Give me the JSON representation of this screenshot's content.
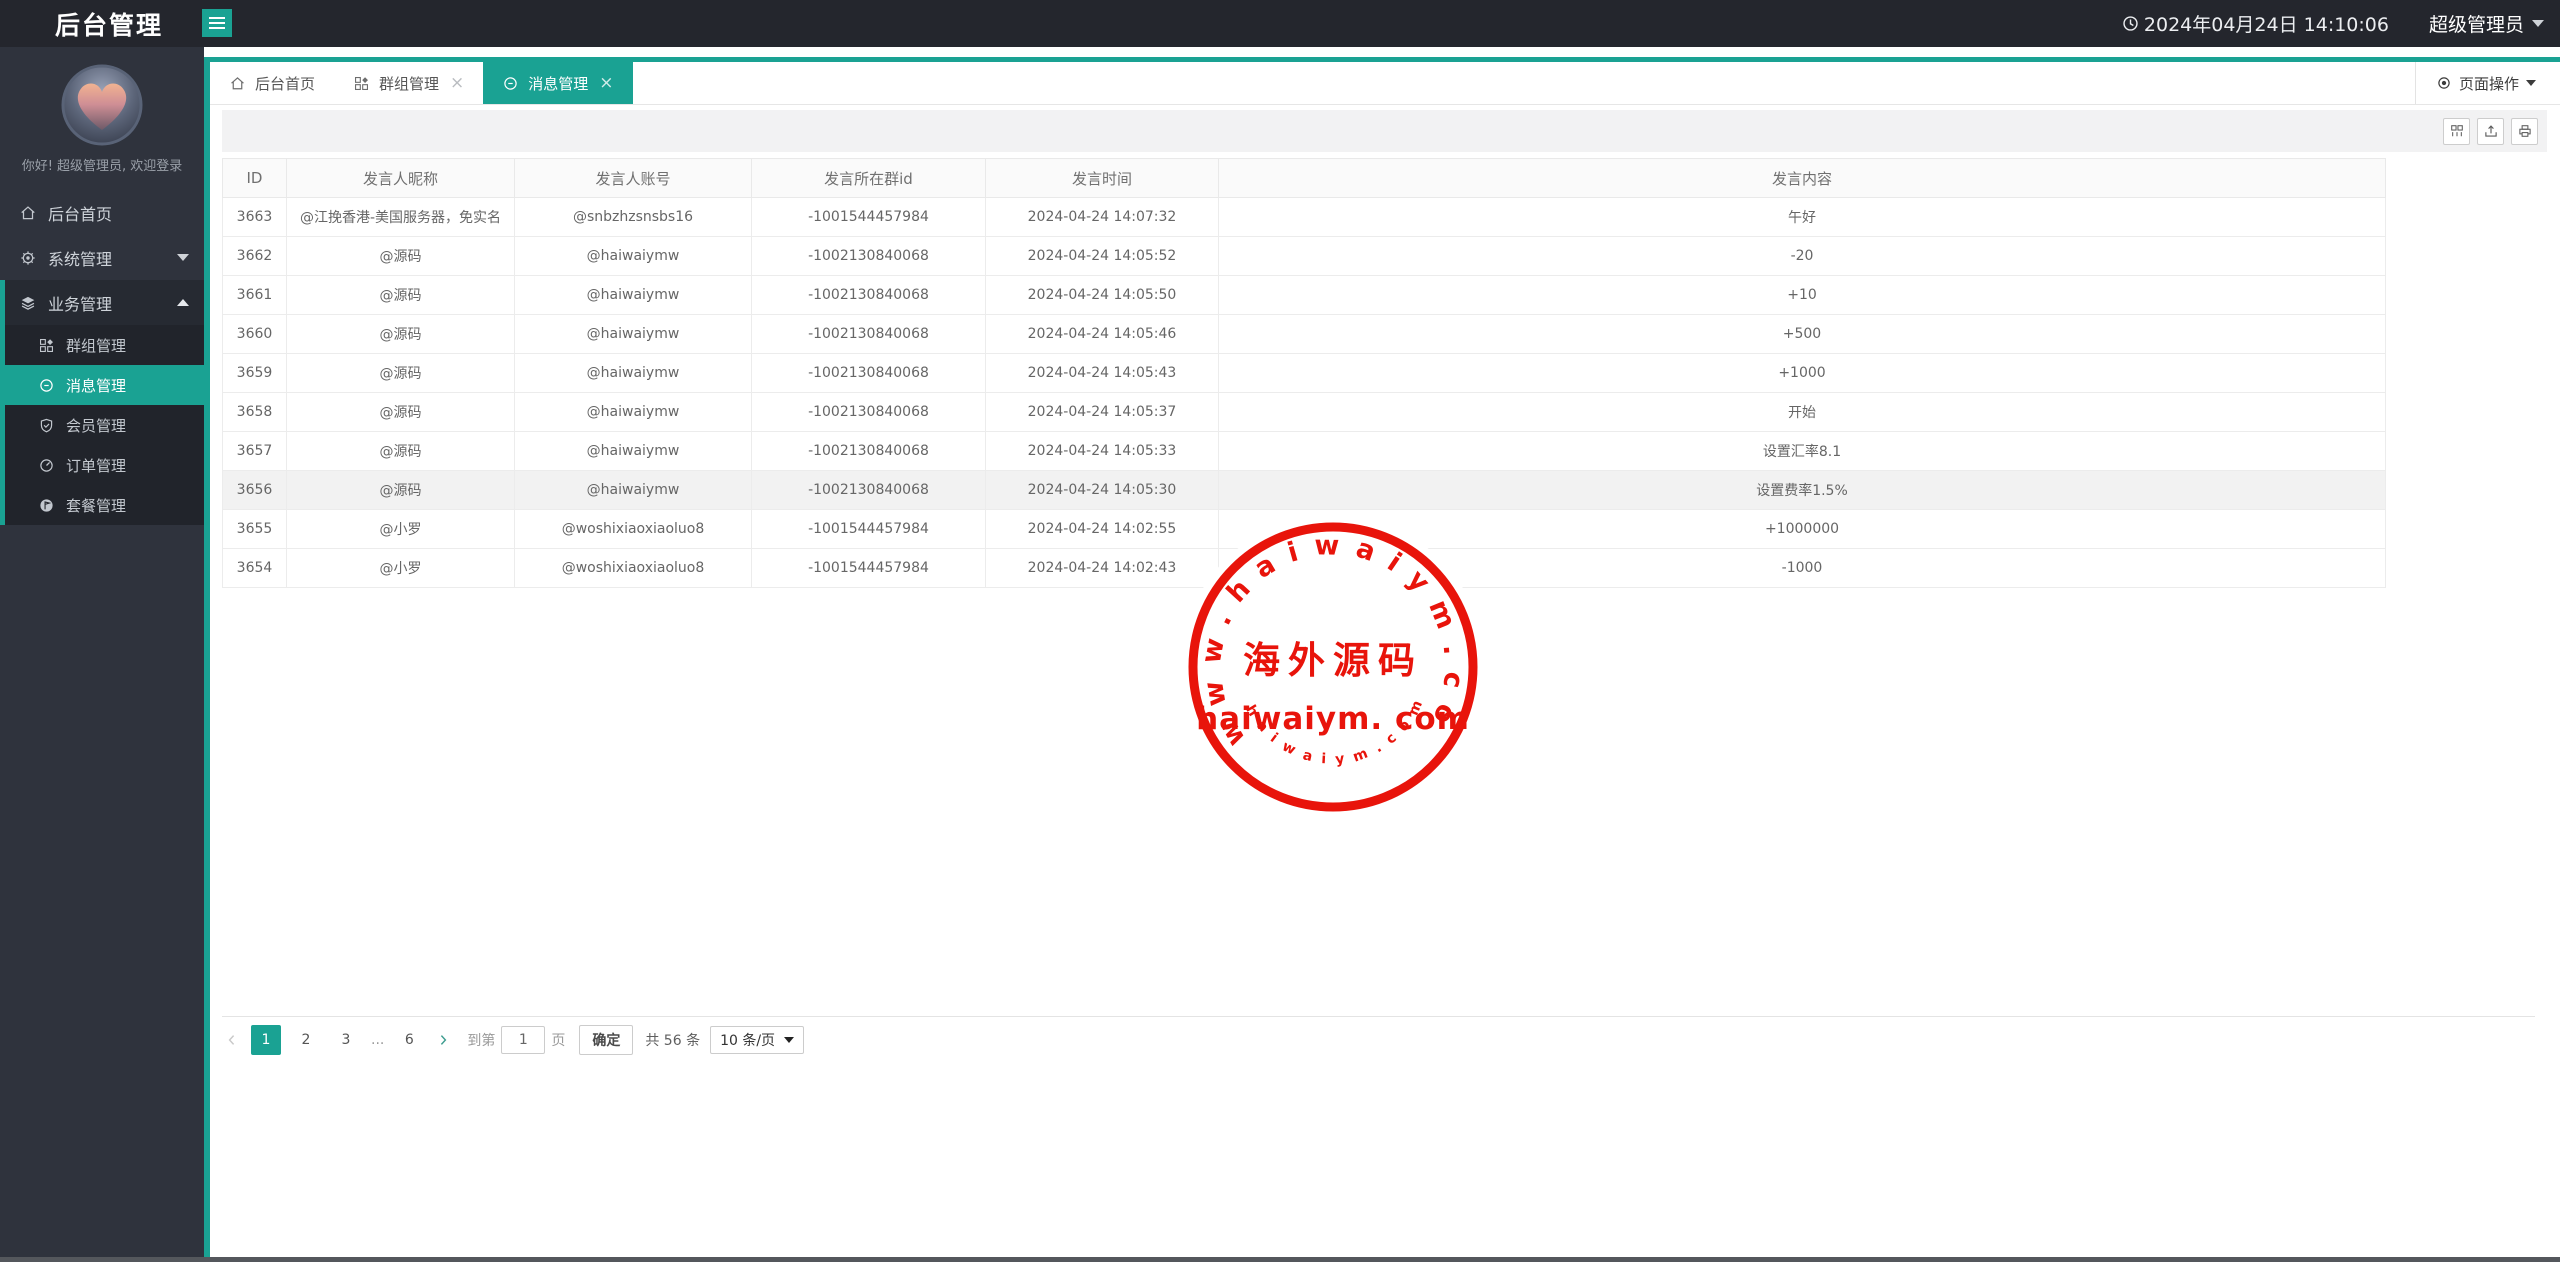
{
  "header": {
    "title": "后台管理",
    "datetime": "2024年04月24日 14:10:06",
    "user": "超级管理员"
  },
  "sidebar": {
    "welcome": "你好! 超级管理员, 欢迎登录",
    "menu": [
      {
        "label": "后台首页",
        "icon": "home-icon"
      },
      {
        "label": "系统管理",
        "icon": "gear-icon",
        "state": "collapsed"
      },
      {
        "label": "业务管理",
        "icon": "layers-icon",
        "state": "expanded"
      }
    ],
    "submenu": [
      {
        "label": "群组管理",
        "icon": "grid-icon"
      },
      {
        "label": "消息管理",
        "icon": "message-icon",
        "active": true
      },
      {
        "label": "会员管理",
        "icon": "shield-icon"
      },
      {
        "label": "订单管理",
        "icon": "gauge-icon"
      },
      {
        "label": "套餐管理",
        "icon": "package-icon"
      }
    ]
  },
  "tabs": [
    {
      "label": "后台首页",
      "icon": "home-icon",
      "closable": false
    },
    {
      "label": "群组管理",
      "icon": "grid-icon",
      "closable": true
    },
    {
      "label": "消息管理",
      "icon": "message-icon",
      "closable": true,
      "active": true
    }
  ],
  "page_actions": {
    "label": "页面操作",
    "icon": "radio-icon"
  },
  "toolbar": {
    "buttons": [
      "columns-icon",
      "export-icon",
      "print-icon"
    ]
  },
  "table": {
    "columns": [
      "ID",
      "发言人昵称",
      "发言人账号",
      "发言所在群id",
      "发言时间",
      "发言内容"
    ],
    "rows": [
      [
        "3663",
        "@江挽香港-美国服务器，免实名",
        "@snbzhzsnsbs16",
        "-1001544457984",
        "2024-04-24 14:07:32",
        "午好"
      ],
      [
        "3662",
        "@源码",
        "@haiwaiymw",
        "-1002130840068",
        "2024-04-24 14:05:52",
        "-20"
      ],
      [
        "3661",
        "@源码",
        "@haiwaiymw",
        "-1002130840068",
        "2024-04-24 14:05:50",
        "+10"
      ],
      [
        "3660",
        "@源码",
        "@haiwaiymw",
        "-1002130840068",
        "2024-04-24 14:05:46",
        "+500"
      ],
      [
        "3659",
        "@源码",
        "@haiwaiymw",
        "-1002130840068",
        "2024-04-24 14:05:43",
        "+1000"
      ],
      [
        "3658",
        "@源码",
        "@haiwaiymw",
        "-1002130840068",
        "2024-04-24 14:05:37",
        "开始"
      ],
      [
        "3657",
        "@源码",
        "@haiwaiymw",
        "-1002130840068",
        "2024-04-24 14:05:33",
        "设置汇率8.1"
      ],
      [
        "3656",
        "@源码",
        "@haiwaiymw",
        "-1002130840068",
        "2024-04-24 14:05:30",
        "设置费率1.5%"
      ],
      [
        "3655",
        "@小罗",
        "@woshixiaoxiaoluo8",
        "-1001544457984",
        "2024-04-24 14:02:55",
        "+1000000"
      ],
      [
        "3654",
        "@小罗",
        "@woshixiaoxiaoluo8",
        "-1001544457984",
        "2024-04-24 14:02:43",
        "-1000"
      ]
    ],
    "highlighted_row_id": "3656"
  },
  "pagination": {
    "pages": [
      "1",
      "2",
      "3",
      "...",
      "6"
    ],
    "active_page": "1",
    "goto_label": "到第",
    "goto_value": "1",
    "page_unit": "页",
    "confirm_label": "确定",
    "total_label": "共 56 条",
    "page_size": "10 条/页"
  },
  "watermark": {
    "top_text": "www.haiwaiym.com",
    "center_cn": "海外源码",
    "center_en": "haiwaiym. com",
    "bottom_text": "haiwaiym.com",
    "color": "#e8140b"
  },
  "ui": {
    "close_glyph": "×"
  },
  "colors": {
    "accent": "#1aa293",
    "topbar_bg": "#24262d",
    "sidebar_bg": "#2f333d",
    "watermark_red": "#e8140b",
    "stripe_row_bg": "#f2f2f2"
  }
}
